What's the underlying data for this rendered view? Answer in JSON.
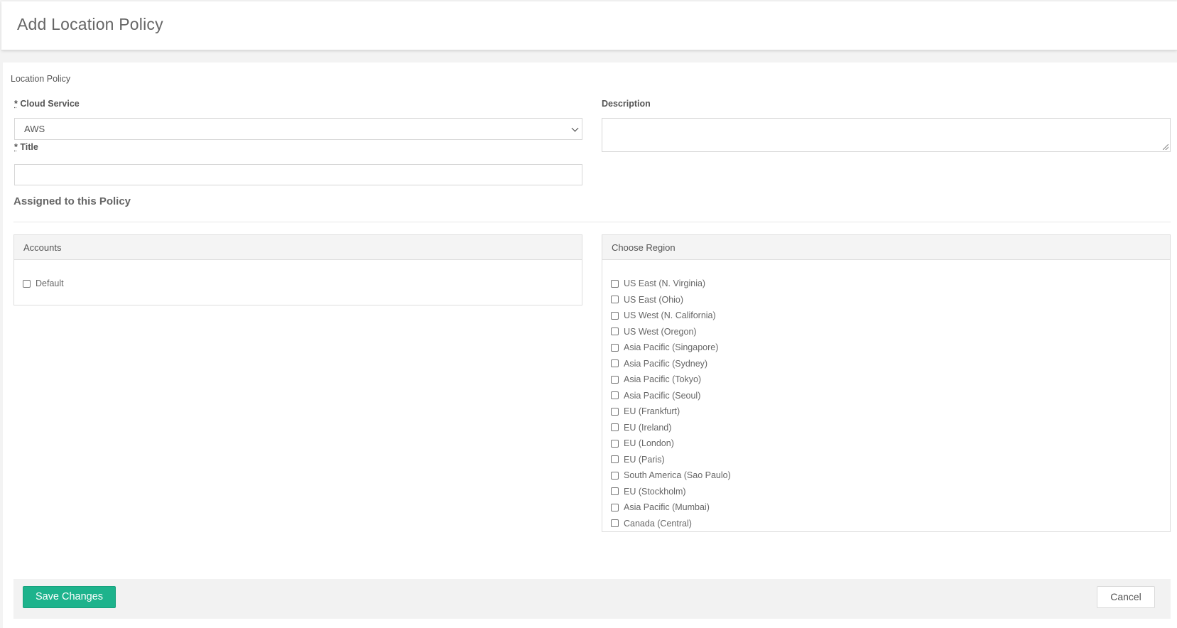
{
  "header": {
    "title": "Add Location Policy"
  },
  "form": {
    "section_label": "Location Policy",
    "cloud_service": {
      "required_mark": "*",
      "label": "Cloud Service",
      "selected": "AWS"
    },
    "title": {
      "required_mark": "*",
      "label": "Title",
      "value": ""
    },
    "description": {
      "label": "Description",
      "value": ""
    }
  },
  "assigned": {
    "heading": "Assigned to this Policy",
    "accounts": {
      "title": "Accounts",
      "items": [
        "Default"
      ]
    },
    "regions": {
      "title": "Choose Region",
      "items": [
        "US East (N. Virginia)",
        "US East (Ohio)",
        "US West (N. California)",
        "US West (Oregon)",
        "Asia Pacific (Singapore)",
        "Asia Pacific (Sydney)",
        "Asia Pacific (Tokyo)",
        "Asia Pacific (Seoul)",
        "EU (Frankfurt)",
        "EU (Ireland)",
        "EU (London)",
        "EU (Paris)",
        "South America (Sao Paulo)",
        "EU (Stockholm)",
        "Asia Pacific (Mumbai)",
        "Canada (Central)"
      ]
    }
  },
  "footer": {
    "save_label": "Save Changes",
    "cancel_label": "Cancel"
  },
  "colors": {
    "primary": "#1db38c"
  }
}
